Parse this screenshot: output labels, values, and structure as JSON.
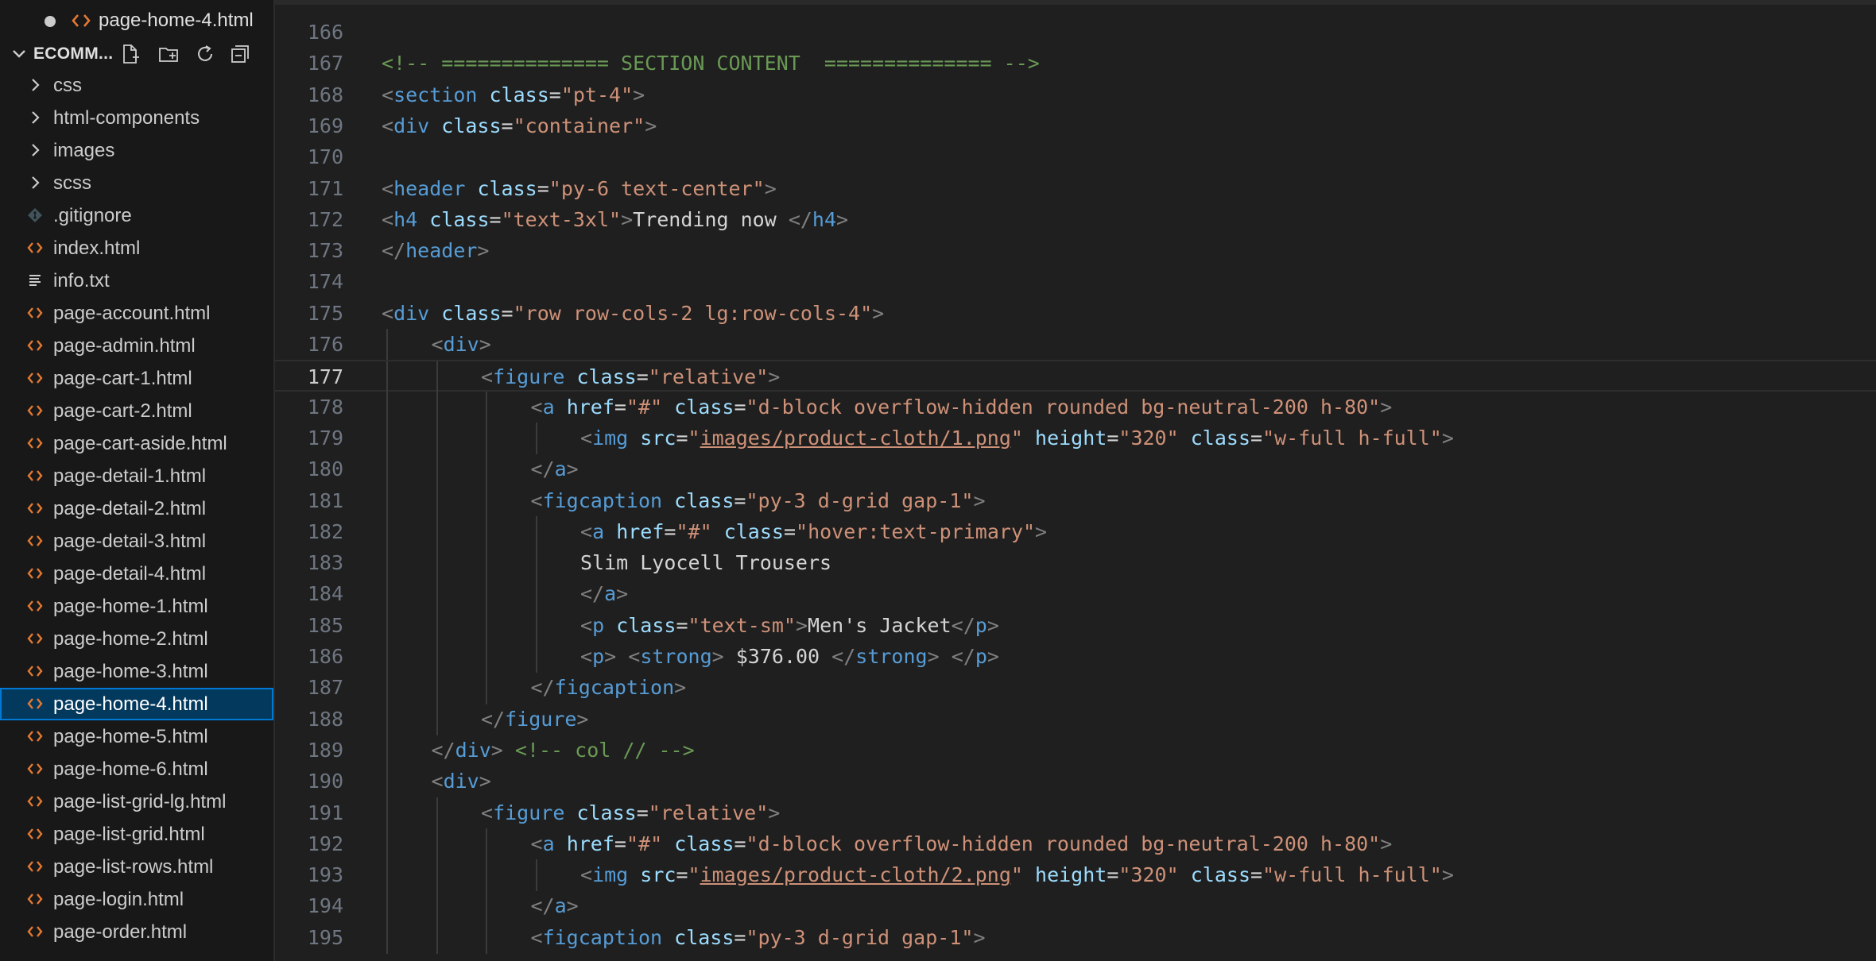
{
  "explorer": {
    "open_editor": {
      "label": "page-home-4.html",
      "modified": true
    },
    "project": {
      "title": "ECOMM...",
      "actions": [
        {
          "name": "new-file-button",
          "icon": "new-file-icon"
        },
        {
          "name": "new-folder-button",
          "icon": "new-folder-icon"
        },
        {
          "name": "refresh-button",
          "icon": "refresh-icon"
        },
        {
          "name": "collapse-all-button",
          "icon": "collapse-all-icon"
        }
      ]
    },
    "items": [
      {
        "label": "css",
        "type": "folder"
      },
      {
        "label": "html-components",
        "type": "folder"
      },
      {
        "label": "images",
        "type": "folder"
      },
      {
        "label": "scss",
        "type": "folder"
      },
      {
        "label": ".gitignore",
        "type": "git"
      },
      {
        "label": "index.html",
        "type": "html"
      },
      {
        "label": "info.txt",
        "type": "text"
      },
      {
        "label": "page-account.html",
        "type": "html"
      },
      {
        "label": "page-admin.html",
        "type": "html"
      },
      {
        "label": "page-cart-1.html",
        "type": "html"
      },
      {
        "label": "page-cart-2.html",
        "type": "html"
      },
      {
        "label": "page-cart-aside.html",
        "type": "html"
      },
      {
        "label": "page-detail-1.html",
        "type": "html"
      },
      {
        "label": "page-detail-2.html",
        "type": "html"
      },
      {
        "label": "page-detail-3.html",
        "type": "html"
      },
      {
        "label": "page-detail-4.html",
        "type": "html"
      },
      {
        "label": "page-home-1.html",
        "type": "html"
      },
      {
        "label": "page-home-2.html",
        "type": "html"
      },
      {
        "label": "page-home-3.html",
        "type": "html"
      },
      {
        "label": "page-home-4.html",
        "type": "html",
        "selected": true
      },
      {
        "label": "page-home-5.html",
        "type": "html"
      },
      {
        "label": "page-home-6.html",
        "type": "html"
      },
      {
        "label": "page-list-grid-lg.html",
        "type": "html"
      },
      {
        "label": "page-list-grid.html",
        "type": "html"
      },
      {
        "label": "page-list-rows.html",
        "type": "html"
      },
      {
        "label": "page-login.html",
        "type": "html"
      },
      {
        "label": "page-order.html",
        "type": "html"
      }
    ]
  },
  "editor": {
    "current_line": "177",
    "lines": [
      {
        "n": "166",
        "indent": 0,
        "tokens": []
      },
      {
        "n": "167",
        "indent": 0,
        "tokens": [
          [
            "com",
            "<!-- ============== SECTION CONTENT  ============== -->"
          ]
        ]
      },
      {
        "n": "168",
        "indent": 0,
        "tokens": [
          [
            "br",
            "<"
          ],
          [
            "tag",
            "section"
          ],
          [
            "txt",
            " "
          ],
          [
            "attr",
            "class"
          ],
          [
            "txt",
            "="
          ],
          [
            "str",
            "\"pt-4\""
          ],
          [
            "br",
            ">"
          ]
        ]
      },
      {
        "n": "169",
        "indent": 0,
        "tokens": [
          [
            "br",
            "<"
          ],
          [
            "tag",
            "div"
          ],
          [
            "txt",
            " "
          ],
          [
            "attr",
            "class"
          ],
          [
            "txt",
            "="
          ],
          [
            "str",
            "\"container\""
          ],
          [
            "br",
            ">"
          ]
        ]
      },
      {
        "n": "170",
        "indent": 0,
        "tokens": []
      },
      {
        "n": "171",
        "indent": 0,
        "tokens": [
          [
            "br",
            "<"
          ],
          [
            "tag",
            "header"
          ],
          [
            "txt",
            " "
          ],
          [
            "attr",
            "class"
          ],
          [
            "txt",
            "="
          ],
          [
            "str",
            "\"py-6 text-center\""
          ],
          [
            "br",
            ">"
          ]
        ]
      },
      {
        "n": "172",
        "indent": 0,
        "tokens": [
          [
            "br",
            "<"
          ],
          [
            "tag",
            "h4"
          ],
          [
            "txt",
            " "
          ],
          [
            "attr",
            "class"
          ],
          [
            "txt",
            "="
          ],
          [
            "str",
            "\"text-3xl\""
          ],
          [
            "br",
            ">"
          ],
          [
            "txt",
            "Trending now "
          ],
          [
            "br",
            "</"
          ],
          [
            "tag",
            "h4"
          ],
          [
            "br",
            ">"
          ]
        ]
      },
      {
        "n": "173",
        "indent": 0,
        "tokens": [
          [
            "br",
            "</"
          ],
          [
            "tag",
            "header"
          ],
          [
            "br",
            ">"
          ]
        ]
      },
      {
        "n": "174",
        "indent": 0,
        "tokens": []
      },
      {
        "n": "175",
        "indent": 0,
        "tokens": [
          [
            "br",
            "<"
          ],
          [
            "tag",
            "div"
          ],
          [
            "txt",
            " "
          ],
          [
            "attr",
            "class"
          ],
          [
            "txt",
            "="
          ],
          [
            "str",
            "\"row row-cols-2 lg:row-cols-4\""
          ],
          [
            "br",
            ">"
          ]
        ]
      },
      {
        "n": "176",
        "indent": 1,
        "tokens": [
          [
            "br",
            "<"
          ],
          [
            "tag",
            "div"
          ],
          [
            "br",
            ">"
          ]
        ]
      },
      {
        "n": "177",
        "indent": 2,
        "tokens": [
          [
            "br",
            "<"
          ],
          [
            "tag",
            "figure"
          ],
          [
            "txt",
            " "
          ],
          [
            "attr",
            "class"
          ],
          [
            "txt",
            "="
          ],
          [
            "str",
            "\"relative\""
          ],
          [
            "br",
            ">"
          ]
        ]
      },
      {
        "n": "178",
        "indent": 3,
        "tokens": [
          [
            "br",
            "<"
          ],
          [
            "tag",
            "a"
          ],
          [
            "txt",
            " "
          ],
          [
            "attr",
            "href"
          ],
          [
            "txt",
            "="
          ],
          [
            "str",
            "\"#\""
          ],
          [
            "txt",
            " "
          ],
          [
            "attr",
            "class"
          ],
          [
            "txt",
            "="
          ],
          [
            "str",
            "\"d-block overflow-hidden rounded bg-neutral-200 h-80\""
          ],
          [
            "br",
            ">"
          ]
        ]
      },
      {
        "n": "179",
        "indent": 4,
        "tokens": [
          [
            "br",
            "<"
          ],
          [
            "tag",
            "img"
          ],
          [
            "txt",
            " "
          ],
          [
            "attr",
            "src"
          ],
          [
            "txt",
            "="
          ],
          [
            "str",
            "\""
          ],
          [
            "link",
            "images/product-cloth/1.png"
          ],
          [
            "str",
            "\""
          ],
          [
            "txt",
            " "
          ],
          [
            "attr",
            "height"
          ],
          [
            "txt",
            "="
          ],
          [
            "str",
            "\"320\""
          ],
          [
            "txt",
            " "
          ],
          [
            "attr",
            "class"
          ],
          [
            "txt",
            "="
          ],
          [
            "str",
            "\"w-full h-full\""
          ],
          [
            "br",
            ">"
          ]
        ]
      },
      {
        "n": "180",
        "indent": 3,
        "tokens": [
          [
            "br",
            "</"
          ],
          [
            "tag",
            "a"
          ],
          [
            "br",
            ">"
          ]
        ]
      },
      {
        "n": "181",
        "indent": 3,
        "tokens": [
          [
            "br",
            "<"
          ],
          [
            "tag",
            "figcaption"
          ],
          [
            "txt",
            " "
          ],
          [
            "attr",
            "class"
          ],
          [
            "txt",
            "="
          ],
          [
            "str",
            "\"py-3 d-grid gap-1\""
          ],
          [
            "br",
            ">"
          ]
        ]
      },
      {
        "n": "182",
        "indent": 4,
        "tokens": [
          [
            "br",
            "<"
          ],
          [
            "tag",
            "a"
          ],
          [
            "txt",
            " "
          ],
          [
            "attr",
            "href"
          ],
          [
            "txt",
            "="
          ],
          [
            "str",
            "\"#\""
          ],
          [
            "txt",
            " "
          ],
          [
            "attr",
            "class"
          ],
          [
            "txt",
            "="
          ],
          [
            "str",
            "\"hover:text-primary\""
          ],
          [
            "br",
            ">"
          ]
        ]
      },
      {
        "n": "183",
        "indent": 4,
        "tokens": [
          [
            "txt",
            "Slim Lyocell Trousers"
          ]
        ]
      },
      {
        "n": "184",
        "indent": 4,
        "tokens": [
          [
            "br",
            "</"
          ],
          [
            "tag",
            "a"
          ],
          [
            "br",
            ">"
          ]
        ]
      },
      {
        "n": "185",
        "indent": 4,
        "tokens": [
          [
            "br",
            "<"
          ],
          [
            "tag",
            "p"
          ],
          [
            "txt",
            " "
          ],
          [
            "attr",
            "class"
          ],
          [
            "txt",
            "="
          ],
          [
            "str",
            "\"text-sm\""
          ],
          [
            "br",
            ">"
          ],
          [
            "txt",
            "Men's Jacket"
          ],
          [
            "br",
            "</"
          ],
          [
            "tag",
            "p"
          ],
          [
            "br",
            ">"
          ]
        ]
      },
      {
        "n": "186",
        "indent": 4,
        "tokens": [
          [
            "br",
            "<"
          ],
          [
            "tag",
            "p"
          ],
          [
            "br",
            ">"
          ],
          [
            "txt",
            " "
          ],
          [
            "br",
            "<"
          ],
          [
            "tag",
            "strong"
          ],
          [
            "br",
            ">"
          ],
          [
            "txt",
            " $376.00 "
          ],
          [
            "br",
            "</"
          ],
          [
            "tag",
            "strong"
          ],
          [
            "br",
            ">"
          ],
          [
            "txt",
            " "
          ],
          [
            "br",
            "</"
          ],
          [
            "tag",
            "p"
          ],
          [
            "br",
            ">"
          ]
        ]
      },
      {
        "n": "187",
        "indent": 3,
        "tokens": [
          [
            "br",
            "</"
          ],
          [
            "tag",
            "figcaption"
          ],
          [
            "br",
            ">"
          ]
        ]
      },
      {
        "n": "188",
        "indent": 2,
        "tokens": [
          [
            "br",
            "</"
          ],
          [
            "tag",
            "figure"
          ],
          [
            "br",
            ">"
          ]
        ]
      },
      {
        "n": "189",
        "indent": 1,
        "tokens": [
          [
            "br",
            "</"
          ],
          [
            "tag",
            "div"
          ],
          [
            "br",
            ">"
          ],
          [
            "txt",
            " "
          ],
          [
            "com",
            "<!-- col // -->"
          ]
        ]
      },
      {
        "n": "190",
        "indent": 1,
        "tokens": [
          [
            "br",
            "<"
          ],
          [
            "tag",
            "div"
          ],
          [
            "br",
            ">"
          ]
        ]
      },
      {
        "n": "191",
        "indent": 2,
        "tokens": [
          [
            "br",
            "<"
          ],
          [
            "tag",
            "figure"
          ],
          [
            "txt",
            " "
          ],
          [
            "attr",
            "class"
          ],
          [
            "txt",
            "="
          ],
          [
            "str",
            "\"relative\""
          ],
          [
            "br",
            ">"
          ]
        ]
      },
      {
        "n": "192",
        "indent": 3,
        "tokens": [
          [
            "br",
            "<"
          ],
          [
            "tag",
            "a"
          ],
          [
            "txt",
            " "
          ],
          [
            "attr",
            "href"
          ],
          [
            "txt",
            "="
          ],
          [
            "str",
            "\"#\""
          ],
          [
            "txt",
            " "
          ],
          [
            "attr",
            "class"
          ],
          [
            "txt",
            "="
          ],
          [
            "str",
            "\"d-block overflow-hidden rounded bg-neutral-200 h-80\""
          ],
          [
            "br",
            ">"
          ]
        ]
      },
      {
        "n": "193",
        "indent": 4,
        "tokens": [
          [
            "br",
            "<"
          ],
          [
            "tag",
            "img"
          ],
          [
            "txt",
            " "
          ],
          [
            "attr",
            "src"
          ],
          [
            "txt",
            "="
          ],
          [
            "str",
            "\""
          ],
          [
            "link",
            "images/product-cloth/2.png"
          ],
          [
            "str",
            "\""
          ],
          [
            "txt",
            " "
          ],
          [
            "attr",
            "height"
          ],
          [
            "txt",
            "="
          ],
          [
            "str",
            "\"320\""
          ],
          [
            "txt",
            " "
          ],
          [
            "attr",
            "class"
          ],
          [
            "txt",
            "="
          ],
          [
            "str",
            "\"w-full h-full\""
          ],
          [
            "br",
            ">"
          ]
        ]
      },
      {
        "n": "194",
        "indent": 3,
        "tokens": [
          [
            "br",
            "</"
          ],
          [
            "tag",
            "a"
          ],
          [
            "br",
            ">"
          ]
        ]
      },
      {
        "n": "195",
        "indent": 3,
        "tokens": [
          [
            "br",
            "<"
          ],
          [
            "tag",
            "figcaption"
          ],
          [
            "txt",
            " "
          ],
          [
            "attr",
            "class"
          ],
          [
            "txt",
            "="
          ],
          [
            "str",
            "\"py-3 d-grid gap-1\""
          ],
          [
            "br",
            ">"
          ]
        ]
      }
    ]
  }
}
